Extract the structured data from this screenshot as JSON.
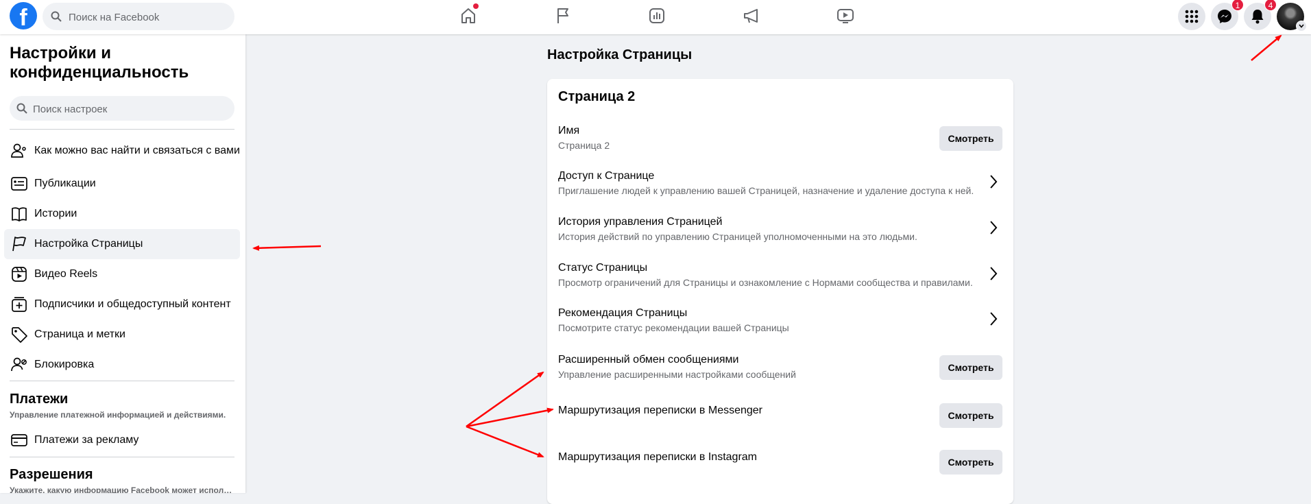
{
  "topbar": {
    "logo_text": "f",
    "search_placeholder": "Поиск на Facebook",
    "nav_icons": [
      "home-icon",
      "flag-icon",
      "insights-icon",
      "megaphone-icon",
      "video-icon"
    ],
    "messenger_badge": "1",
    "notifications_badge": "4",
    "colors": {
      "brand": "#1877f2",
      "badge": "#e41e3f"
    }
  },
  "sidebar": {
    "title": "Настройки и конфиденциальность",
    "search_placeholder": "Поиск настроек",
    "items": [
      {
        "label": "Как можно вас найти и связаться с вами",
        "icon": "person-contact-icon"
      },
      {
        "label": "Публикации",
        "icon": "posts-icon"
      },
      {
        "label": "Истории",
        "icon": "book-icon"
      },
      {
        "label": "Настройка Страницы",
        "icon": "flag-icon",
        "active": true
      },
      {
        "label": "Видео Reels",
        "icon": "reels-icon"
      },
      {
        "label": "Подписчики и общедоступный контент",
        "icon": "add-content-icon"
      },
      {
        "label": "Страница и метки",
        "icon": "tag-icon"
      },
      {
        "label": "Блокировка",
        "icon": "block-person-icon"
      }
    ],
    "payments": {
      "title": "Платежи",
      "subtitle": "Управление платежной информацией и действиями.",
      "items": [
        {
          "label": "Платежи за рекламу",
          "icon": "card-icon"
        }
      ]
    },
    "permissions": {
      "title": "Разрешения",
      "subtitle": "Укажите, какую информацию Facebook может использовать"
    }
  },
  "main": {
    "heading": "Настройка Страницы",
    "card_title": "Страница 2",
    "view_label": "Смотреть",
    "rows": [
      {
        "title": "Имя",
        "subtitle": "Страница 2",
        "action": "button"
      },
      {
        "title": "Доступ к Странице",
        "subtitle": "Приглашение людей к управлению вашей Страницей, назначение и удаление доступа к ней.",
        "action": "chevron"
      },
      {
        "title": "История управления Страницей",
        "subtitle": "История действий по управлению Страницей уполномоченными на это людьми.",
        "action": "chevron"
      },
      {
        "title": "Статус Страницы",
        "subtitle": "Просмотр ограничений для Страницы и ознакомление с Нормами сообщества и правилами.",
        "action": "chevron"
      },
      {
        "title": "Рекомендация Страницы",
        "subtitle": "Посмотрите статус рекомендации вашей Страницы",
        "action": "chevron"
      },
      {
        "title": "Расширенный обмен сообщениями",
        "subtitle": "Управление расширенными настройками сообщений",
        "action": "button"
      },
      {
        "title": "Маршрутизация переписки в Messenger",
        "subtitle": "",
        "action": "button"
      },
      {
        "title": "Маршрутизация переписки в Instagram",
        "subtitle": "",
        "action": "button"
      }
    ]
  },
  "annotations": {
    "arrow_color": "#ff0000"
  }
}
